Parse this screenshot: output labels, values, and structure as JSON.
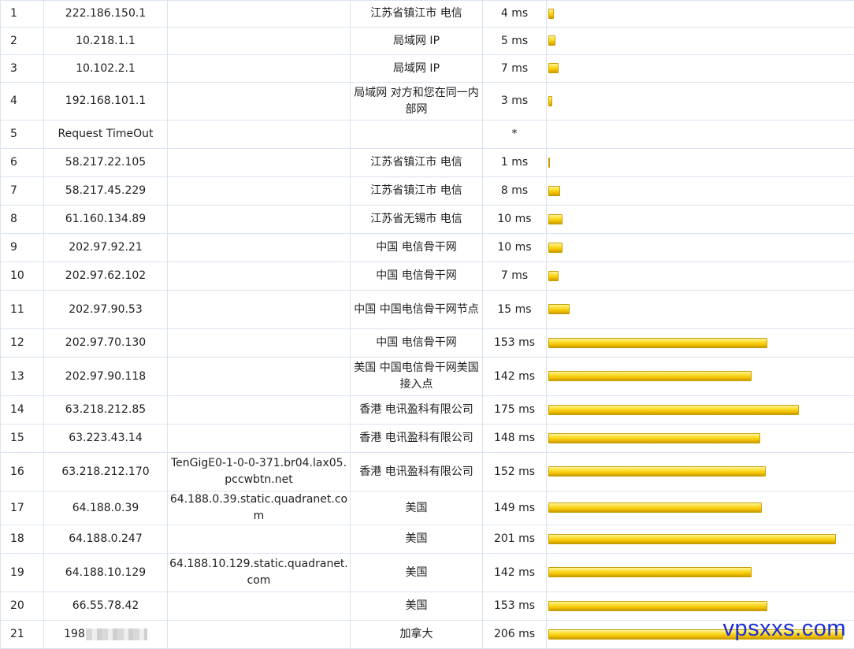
{
  "bar_color": "#f2c200",
  "watermark": "vpsxxs.com",
  "rows": [
    {
      "hop": "1",
      "ip": "222.186.150.1",
      "host": "",
      "location": "江苏省镇江市 电信",
      "latency": "4 ms",
      "ms": 4
    },
    {
      "hop": "2",
      "ip": "10.218.1.1",
      "host": "",
      "location": "局域网 IP",
      "latency": "5 ms",
      "ms": 5
    },
    {
      "hop": "3",
      "ip": "10.102.2.1",
      "host": "",
      "location": "局域网 IP",
      "latency": "7 ms",
      "ms": 7
    },
    {
      "hop": "4",
      "ip": "192.168.101.1",
      "host": "",
      "location": "局域网 对方和您在同一内部网",
      "latency": "3 ms",
      "ms": 3
    },
    {
      "hop": "5",
      "ip": "Request TimeOut",
      "host": "",
      "location": "",
      "latency": "*",
      "ms": 0
    },
    {
      "hop": "6",
      "ip": "58.217.22.105",
      "host": "",
      "location": "江苏省镇江市 电信",
      "latency": "1 ms",
      "ms": 1
    },
    {
      "hop": "7",
      "ip": "58.217.45.229",
      "host": "",
      "location": "江苏省镇江市 电信",
      "latency": "8 ms",
      "ms": 8
    },
    {
      "hop": "8",
      "ip": "61.160.134.89",
      "host": "",
      "location": "江苏省无锡市 电信",
      "latency": "10 ms",
      "ms": 10
    },
    {
      "hop": "9",
      "ip": "202.97.92.21",
      "host": "",
      "location": "中国 电信骨干网",
      "latency": "10 ms",
      "ms": 10
    },
    {
      "hop": "10",
      "ip": "202.97.62.102",
      "host": "",
      "location": "中国 电信骨干网",
      "latency": "7 ms",
      "ms": 7
    },
    {
      "hop": "11",
      "ip": "202.97.90.53",
      "host": "",
      "location": "中国 中国电信骨干网节点",
      "latency": "15 ms",
      "ms": 15
    },
    {
      "hop": "12",
      "ip": "202.97.70.130",
      "host": "",
      "location": "中国 电信骨干网",
      "latency": "153 ms",
      "ms": 153
    },
    {
      "hop": "13",
      "ip": "202.97.90.118",
      "host": "",
      "location": "美国 中国电信骨干网美国接入点",
      "latency": "142 ms",
      "ms": 142
    },
    {
      "hop": "14",
      "ip": "63.218.212.85",
      "host": "",
      "location": "香港 电讯盈科有限公司",
      "latency": "175 ms",
      "ms": 175
    },
    {
      "hop": "15",
      "ip": "63.223.43.14",
      "host": "",
      "location": "香港 电讯盈科有限公司",
      "latency": "148 ms",
      "ms": 148
    },
    {
      "hop": "16",
      "ip": "63.218.212.170",
      "host": "TenGigE0-1-0-0-371.br04.lax05.pccwbtn.net",
      "location": "香港 电讯盈科有限公司",
      "latency": "152 ms",
      "ms": 152
    },
    {
      "hop": "17",
      "ip": "64.188.0.39",
      "host": "64.188.0.39.static.quadranet.com",
      "location": "美国",
      "latency": "149 ms",
      "ms": 149
    },
    {
      "hop": "18",
      "ip": "64.188.0.247",
      "host": "",
      "location": "美国",
      "latency": "201 ms",
      "ms": 201
    },
    {
      "hop": "19",
      "ip": "64.188.10.129",
      "host": "64.188.10.129.static.quadranet.com",
      "location": "美国",
      "latency": "142 ms",
      "ms": 142
    },
    {
      "hop": "20",
      "ip": "66.55.78.42",
      "host": "",
      "location": "美国",
      "latency": "153 ms",
      "ms": 153
    },
    {
      "hop": "21",
      "ip": "198",
      "host": "",
      "location": "加拿大",
      "latency": "206 ms",
      "ms": 206,
      "masked": true
    }
  ]
}
